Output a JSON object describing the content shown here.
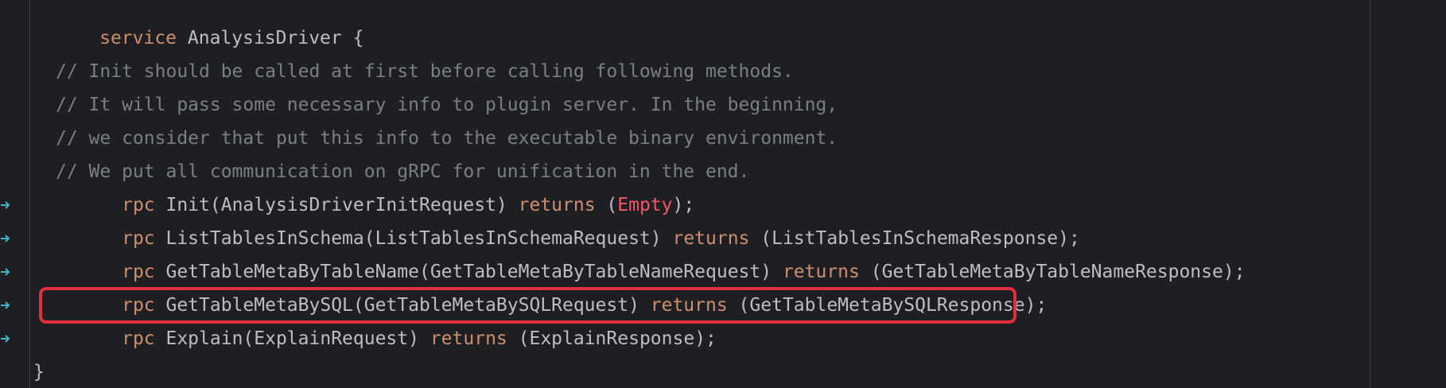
{
  "code": {
    "service_keyword": "service",
    "service_name": " AnalysisDriver {",
    "comments": [
      "// Init should be called at first before calling following methods.",
      "// It will pass some necessary info to plugin server. In the beginning,",
      "// we consider that put this info to the executable binary environment.",
      "// We put all communication on gRPC for unification in the end."
    ],
    "rpc_keyword": "rpc",
    "returns_keyword": "returns",
    "rpcs": [
      {
        "signature": " Init(AnalysisDriverInitRequest) ",
        "open": " (",
        "response": "Empty",
        "close": ");"
      },
      {
        "signature": " ListTablesInSchema(ListTablesInSchemaRequest) ",
        "open": " (",
        "response": "ListTablesInSchemaResponse",
        "close": ");"
      },
      {
        "signature": " GetTableMetaByTableName(GetTableMetaByTableNameRequest) ",
        "open": " (",
        "response": "GetTableMetaByTableNameResponse",
        "close": ");"
      },
      {
        "signature": " GetTableMetaBySQL(GetTableMetaBySQLRequest) ",
        "open": " (",
        "response": "GetTableMetaBySQLResponse",
        "close": ");"
      },
      {
        "signature": " Explain(ExplainRequest) ",
        "open": " (",
        "response": "ExplainResponse",
        "close": ");"
      }
    ],
    "closing_brace": "}"
  },
  "colors": {
    "background": "#1e1f22",
    "keyword": "#cf8e6d",
    "comment": "#7a7e85",
    "identifier": "#bcbec4",
    "special_type": "#f75464",
    "highlight_border": "#e0303c",
    "gutter_marker": "#3fb6c8"
  },
  "icons": {
    "gutter_marker": "implement-arrow-icon"
  }
}
